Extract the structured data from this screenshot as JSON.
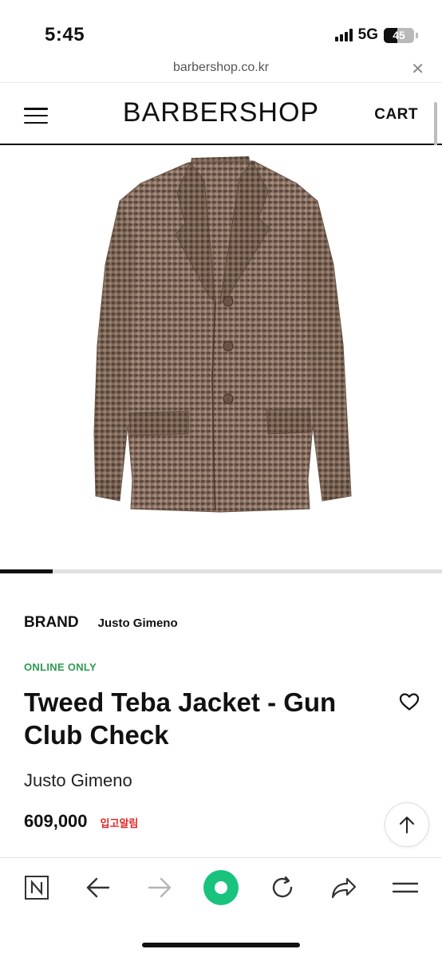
{
  "status_bar": {
    "time": "5:45",
    "network": "5G",
    "battery": "45",
    "battery_level": 0.45
  },
  "browser": {
    "url": "barbershop.co.kr",
    "close_icon": "close-icon"
  },
  "header": {
    "logo": "BARBERSHOP",
    "cart_label": "CART",
    "menu_icon": "hamburger-menu-icon"
  },
  "gallery": {
    "image_alt": "Tweed Teba Jacket - Gun Club Check",
    "slide_progress": 0.12
  },
  "product": {
    "brand_label": "BRAND",
    "brand_name": "Justo Gimeno",
    "badge": "ONLINE ONLY",
    "title": "Tweed Teba Jacket - Gun Club Check",
    "maker": "Justo Gimeno",
    "price": "609,000",
    "restock_alert": "입고알림"
  },
  "colors": {
    "accent_green": "#2f9a52",
    "alert_red": "#e02424",
    "nav_green": "#19c37d"
  },
  "toolbar": {
    "items": [
      "naver-n-icon",
      "back-arrow-icon",
      "forward-arrow-icon",
      "green-dot-icon",
      "reload-icon",
      "share-icon",
      "menu-icon"
    ]
  }
}
